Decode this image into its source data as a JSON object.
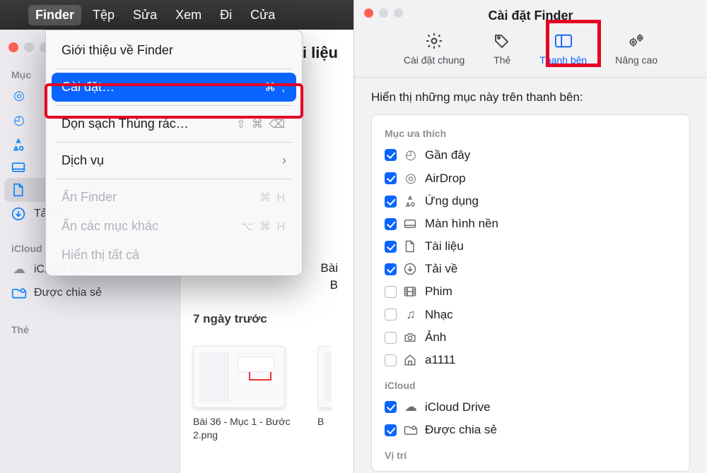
{
  "menubar": {
    "items": [
      "Finder",
      "Tệp",
      "Sửa",
      "Xem",
      "Đi",
      "Cửa"
    ],
    "active_index": 0
  },
  "dropmenu": {
    "about": {
      "label": "Giới thiệu về Finder"
    },
    "settings": {
      "label": "Cài đặt…",
      "shortcut": "⌘  ,"
    },
    "empty_trash": {
      "label": "Dọn sạch Thùng rác…",
      "shortcut": "⇧ ⌘ ⌫"
    },
    "services": {
      "label": "Dịch vụ"
    },
    "hide_finder": {
      "label": "Ẩn Finder",
      "shortcut": "⌘ H"
    },
    "hide_others": {
      "label": "Ẩn các mục khác",
      "shortcut": "⌥ ⌘ H"
    },
    "show_all": {
      "label": "Hiển thị tất cả"
    }
  },
  "finder_window": {
    "title_suffix": "i liệu",
    "sidebar": {
      "section_favorites": "Mục",
      "airdrop": "",
      "recent": "",
      "apps": "",
      "desktop": "",
      "documents": "",
      "downloads": "Tải về",
      "section_icloud": "iCloud",
      "icloud_drive": "iCloud Drive",
      "shared": "Được chia sẻ",
      "section_tags": "Thẻ"
    },
    "content": {
      "row1": "Bài",
      "row1b": "B",
      "time_group": "7 ngày trước",
      "thumb1_label": "Bài 36 - Mục 1 - Bước 2.png",
      "thumb2_label": "B"
    }
  },
  "settings_window": {
    "title": "Cài đặt Finder",
    "tabs": {
      "general": "Cài đặt chung",
      "tags": "Thẻ",
      "sidebar": "Thanh bên",
      "advanced": "Nâng cao"
    },
    "heading": "Hiển thị những mục này trên thanh bên:",
    "favorites_section": "Mục ưa thích",
    "items": {
      "recents": {
        "label": "Gần đây",
        "checked": true
      },
      "airdrop": {
        "label": "AirDrop",
        "checked": true
      },
      "apps": {
        "label": "Ứng dụng",
        "checked": true
      },
      "desktop": {
        "label": "Màn hình nền",
        "checked": true
      },
      "documents": {
        "label": "Tài liệu",
        "checked": true
      },
      "downloads": {
        "label": "Tải về",
        "checked": true
      },
      "movies": {
        "label": "Phim",
        "checked": false
      },
      "music": {
        "label": "Nhạc",
        "checked": false
      },
      "pictures": {
        "label": "Ảnh",
        "checked": false
      },
      "home": {
        "label": "a1111",
        "checked": false
      }
    },
    "icloud_section": "iCloud",
    "icloud_items": {
      "drive": {
        "label": "iCloud Drive",
        "checked": true
      },
      "shared": {
        "label": "Được chia sẻ",
        "checked": true
      }
    },
    "locations_section": "Vị trí"
  }
}
